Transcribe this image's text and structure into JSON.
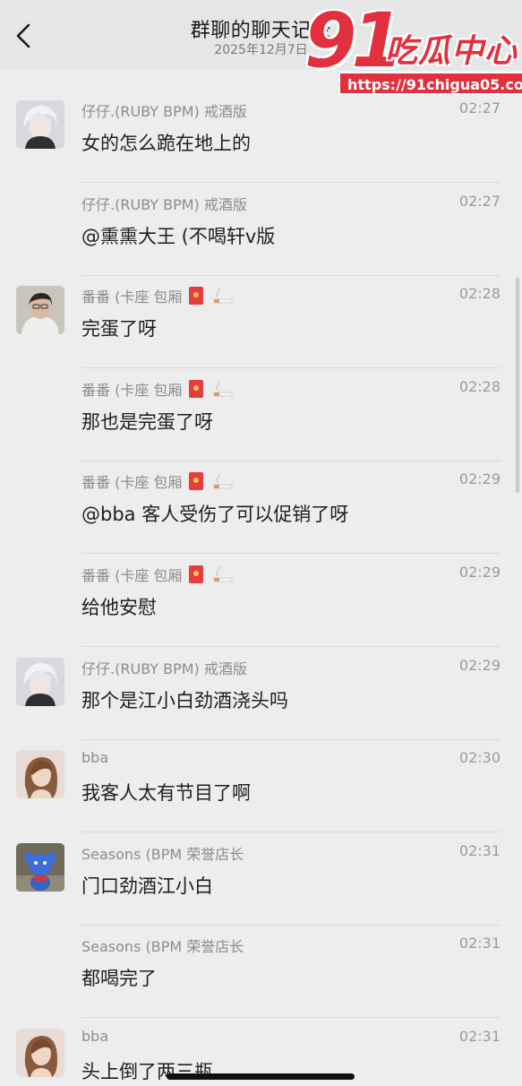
{
  "header": {
    "title": "群聊的聊天记录",
    "date": "2025年12月7日"
  },
  "watermark": {
    "logo_number": "91",
    "logo_name": "吃瓜中心",
    "url": "https://91chigua05.com"
  },
  "messages": [
    {
      "name": "仔仔.(RUBY BPM) 戒酒版",
      "time": "02:27",
      "text": "女的怎么跪在地上的",
      "avatar": "anime-boy-avatar",
      "badges": false
    },
    {
      "name": "仔仔.(RUBY BPM) 戒酒版",
      "time": "02:27",
      "text": "@熏熏大王 (不喝轩v版",
      "avatar": null,
      "badges": false
    },
    {
      "name": "番番 (卡座 包厢",
      "time": "02:28",
      "text": "完蛋了呀",
      "avatar": "selfie-avatar",
      "badges": true
    },
    {
      "name": "番番 (卡座 包厢",
      "time": "02:28",
      "text": "那也是完蛋了呀",
      "avatar": null,
      "badges": true
    },
    {
      "name": "番番 (卡座 包厢",
      "time": "02:29",
      "text": "@bba 客人受伤了可以促销了呀",
      "avatar": null,
      "badges": true
    },
    {
      "name": "番番 (卡座 包厢",
      "time": "02:29",
      "text": "给他安慰",
      "avatar": null,
      "badges": true
    },
    {
      "name": "仔仔.(RUBY BPM) 戒酒版",
      "time": "02:29",
      "text": "那个是江小白劲酒浇头吗",
      "avatar": "anime-boy-avatar",
      "badges": false
    },
    {
      "name": "bba",
      "time": "02:30",
      "text": "我客人太有节目了啊",
      "avatar": "woman-avatar",
      "badges": false
    },
    {
      "name": "Seasons (BPM 荣誉店长",
      "time": "02:31",
      "text": "门口劲酒江小白",
      "avatar": "blue-toy-avatar",
      "badges": false
    },
    {
      "name": "Seasons (BPM 荣誉店长",
      "time": "02:31",
      "text": "都喝完了",
      "avatar": null,
      "badges": false
    },
    {
      "name": "bba",
      "time": "02:31",
      "text": "头上倒了两三瓶",
      "avatar": "woman-avatar",
      "badges": false
    }
  ],
  "colors": {
    "background": "#ededed",
    "header_bg": "#e6e6e6",
    "watermark_red": "#e3303f",
    "envelope_red": "#e43d3d"
  }
}
